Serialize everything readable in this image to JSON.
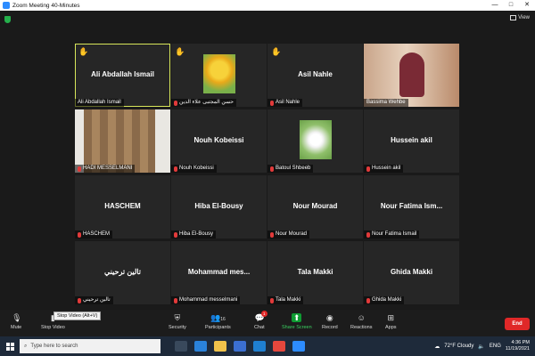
{
  "window": {
    "title": "Zoom Meeting 40-Minutes",
    "controls": [
      "—",
      "□",
      "✕"
    ]
  },
  "top_bar": {
    "view_label": "View"
  },
  "participants": [
    {
      "big_name": "Ali Abdallah Ismail",
      "label": "Ali Abdallah Ismail",
      "hand": true,
      "muted": false,
      "active": true,
      "type": "name"
    },
    {
      "big_name": "",
      "label": "حسن المجتبى علاء الدين",
      "hand": true,
      "muted": true,
      "active": false,
      "type": "tulips"
    },
    {
      "big_name": "Asil Nahle",
      "label": "Asil Nahle",
      "hand": true,
      "muted": true,
      "active": false,
      "type": "name"
    },
    {
      "big_name": "",
      "label": "Bassima Wehbe",
      "hand": false,
      "muted": false,
      "active": false,
      "type": "video-person"
    },
    {
      "big_name": "",
      "label": "HADI MESSELMANI",
      "hand": false,
      "muted": true,
      "active": false,
      "type": "video-door"
    },
    {
      "big_name": "Nouh Kobeissi",
      "label": "Nouh Kobeissi",
      "hand": false,
      "muted": true,
      "active": false,
      "type": "name"
    },
    {
      "big_name": "",
      "label": "Batoul Shbeeb",
      "hand": false,
      "muted": true,
      "active": false,
      "type": "flower"
    },
    {
      "big_name": "Hussein akil",
      "label": "Hussein akil",
      "hand": false,
      "muted": true,
      "active": false,
      "type": "name"
    },
    {
      "big_name": "HASCHEM",
      "label": "HASCHEM",
      "hand": false,
      "muted": true,
      "active": false,
      "type": "name"
    },
    {
      "big_name": "Hiba El-Bousy",
      "label": "Hiba El-Bousy",
      "hand": false,
      "muted": true,
      "active": false,
      "type": "name"
    },
    {
      "big_name": "Nour Mourad",
      "label": "Nour Mourad",
      "hand": false,
      "muted": true,
      "active": false,
      "type": "name"
    },
    {
      "big_name": "Nour Fatima  Ism...",
      "label": "Nour Fatima Ismail",
      "hand": false,
      "muted": true,
      "active": false,
      "type": "name"
    },
    {
      "big_name": "تالين ترحيني",
      "label": "تالين ترحيني",
      "hand": false,
      "muted": true,
      "active": false,
      "type": "name"
    },
    {
      "big_name": "Mohammad  mes...",
      "label": "Mohammad messelmani",
      "hand": false,
      "muted": true,
      "active": false,
      "type": "name"
    },
    {
      "big_name": "Tala Makki",
      "label": "Tala Makki",
      "hand": false,
      "muted": true,
      "active": false,
      "type": "name"
    },
    {
      "big_name": "Ghida Makki",
      "label": "Ghida Makki",
      "hand": false,
      "muted": true,
      "active": false,
      "type": "name"
    }
  ],
  "controls": {
    "mute": "Mute",
    "stop_video": "Stop Video",
    "tooltip": "Stop Video (Alt+V)",
    "security": "Security",
    "participants": "Participants",
    "participants_count": "16",
    "chat": "Chat",
    "chat_badge": "1",
    "share": "Share Screen",
    "record": "Record",
    "reactions": "Reactions",
    "apps": "Apps",
    "end": "End"
  },
  "taskbar": {
    "search_placeholder": "Type here to search",
    "weather": "72°F  Cloudy",
    "lang": "ENG",
    "time": "4:36 PM",
    "date": "11/19/2021"
  }
}
